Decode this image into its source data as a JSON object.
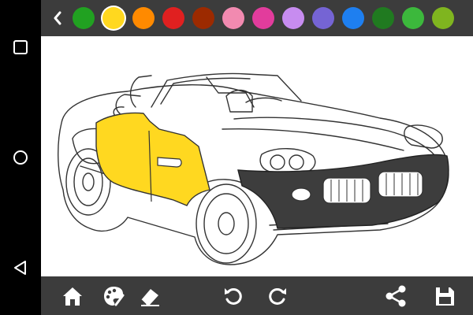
{
  "nav": {
    "recent_icon": "square-icon",
    "home_icon": "circle-icon",
    "back_icon": "triangle-back-icon"
  },
  "palette": {
    "back_icon": "chevron-left-icon",
    "colors": [
      "#21a121",
      "#ffd81f",
      "#ff8a00",
      "#e02020",
      "#9c2a00",
      "#f28ab0",
      "#e23c9c",
      "#c78cf0",
      "#7564d4",
      "#1e7ff0",
      "#207a20",
      "#3cb83c",
      "#7fb51f"
    ],
    "selected_index": 1
  },
  "canvas": {
    "fills": {
      "door": "#ffd820",
      "front_bumper": "#3d3d3d"
    }
  },
  "toolbar": {
    "icons": [
      "home-icon",
      "palette-icon",
      "eraser-icon",
      "undo-icon",
      "redo-icon",
      "share-icon",
      "save-icon"
    ]
  }
}
